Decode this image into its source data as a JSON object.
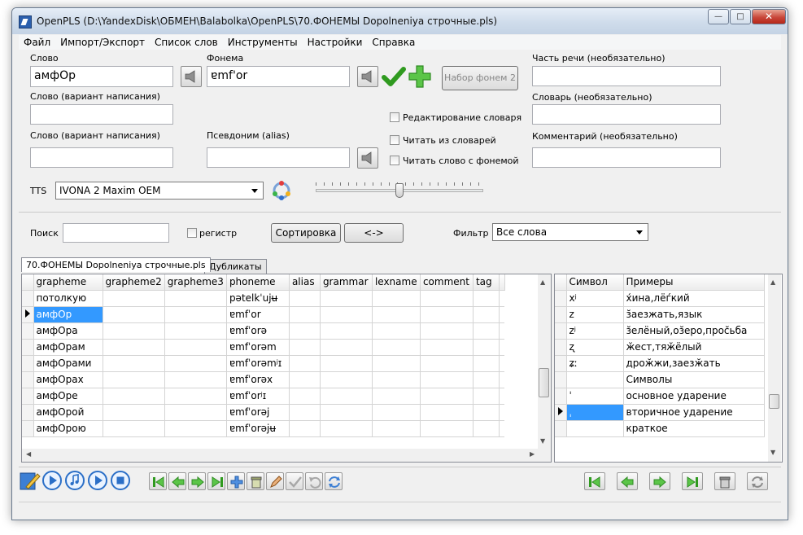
{
  "window": {
    "title": "OpenPLS (D:\\YandexDisk\\ОБМЕН\\Balabolka\\OpenPLS\\70.ФОНЕМЫ Dopolneniya строчные.pls)",
    "minimize": "—",
    "maximize": "□",
    "close": "✕"
  },
  "menu": [
    "Файл",
    "Импорт/Экспорт",
    "Список слов",
    "Инструменты",
    "Настройки",
    "Справка"
  ],
  "form": {
    "word_label": "Слово",
    "word_value": "амфОр",
    "phoneme_label": "Фонема",
    "phoneme_value": "ɐmf'or",
    "phoneme_set_button": "Набор фонем 2",
    "pos_label": "Часть речи (необязательно)",
    "pos_value": "",
    "spelling1_label": "Слово (вариант написания)",
    "spelling1_value": "",
    "spelling2_label": "Слово (вариант написания)",
    "spelling2_value": "",
    "alias_label": "Псевдоним (alias)",
    "alias_value": "",
    "edit_dict_label": "Редактирование словаря",
    "read_dicts_label": "Читать из словарей",
    "read_phoneme_label": "Читать слово с фонемой",
    "dictionary_label": "Словарь (необязательно)",
    "dictionary_value": "",
    "comment_label": "Комментарий (необязательно)",
    "comment_value": "",
    "tts_label": "TTS",
    "tts_voice": "IVONA 2 Maxim OEM",
    "tts_rate": 0.5
  },
  "search": {
    "label": "Поиск",
    "value": "",
    "case_label": "регистр",
    "sort_button": "Сортировка",
    "swap_button": "<->",
    "filter_label": "Фильтр",
    "filter_value": "Все слова"
  },
  "tabs": [
    "70.ФОНЕМЫ Dopolneniya строчные.pls",
    "Дубликаты"
  ],
  "grid": {
    "columns": [
      "grapheme",
      "grapheme2",
      "grapheme3",
      "phoneme",
      "alias",
      "grammar",
      "lexname",
      "comment",
      "tag"
    ],
    "rows": [
      {
        "grapheme": "потолкую",
        "phoneme": "pətelkˈujʉ"
      },
      {
        "grapheme": "амфОр",
        "phoneme": "ɐmfˈor"
      },
      {
        "grapheme": "амфОра",
        "phoneme": "ɐmfˈorə"
      },
      {
        "grapheme": "амфОрам",
        "phoneme": "ɐmfˈorəm"
      },
      {
        "grapheme": "амфОрами",
        "phoneme": "ɐmfˈorəmʲɪ"
      },
      {
        "grapheme": "амфОрах",
        "phoneme": "ɐmfˈorəx"
      },
      {
        "grapheme": "амфОре",
        "phoneme": "ɐmfˈorʲɪ"
      },
      {
        "grapheme": "амфОрой",
        "phoneme": "ɐmfˈorəj"
      },
      {
        "grapheme": "амфОрою",
        "phoneme": "ɐmfˈorəjʉ"
      }
    ],
    "selected_row": 1
  },
  "symbols": {
    "col_symbol": "Символ",
    "col_examples": "Примеры",
    "rows": [
      {
        "symbol": "xʲ",
        "example": "х́ина,лёѓкий"
      },
      {
        "symbol": "z",
        "example": "з̆аезжать,язык"
      },
      {
        "symbol": "zʲ",
        "example": "з̆елёный,оз̆еро,прос̆ьба"
      },
      {
        "symbol": "ʐ",
        "example": "ӂест,тяӂёлый"
      },
      {
        "symbol": "ʑː",
        "example": "дроӂжи,заезӂать"
      },
      {
        "symbol": "",
        "example": "Символы"
      },
      {
        "symbol": "ˈ",
        "example": "основное ударение"
      },
      {
        "symbol": "ˌ",
        "example": "вторичное ударение"
      },
      {
        "symbol": "",
        "example": "краткое"
      }
    ],
    "selected_row": 7
  }
}
